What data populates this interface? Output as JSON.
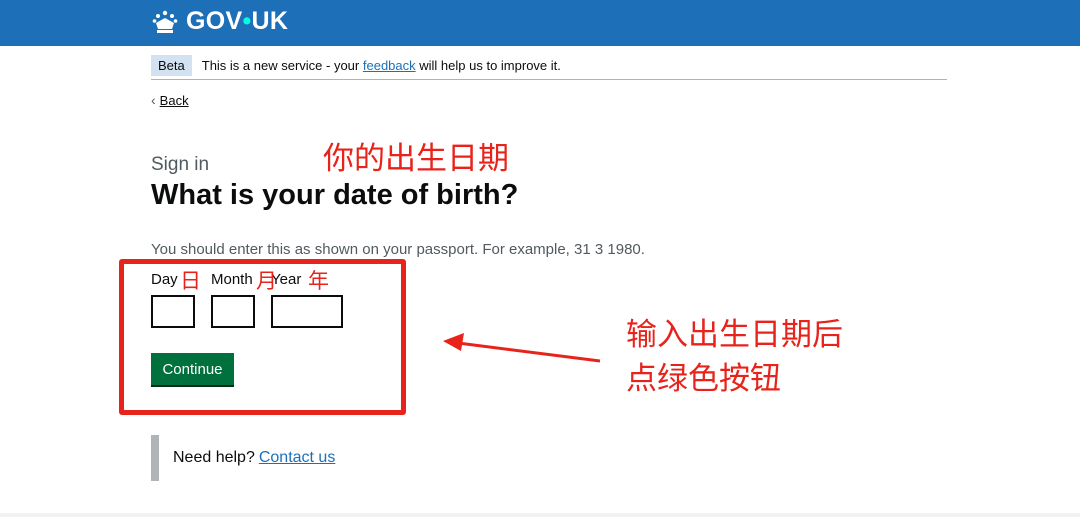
{
  "header": {
    "logo_text_left": "GOV",
    "logo_dot": "•",
    "logo_text_right": "UK",
    "brand_color": "#1d70b8"
  },
  "phase_banner": {
    "tag": "Beta",
    "text_before": "This is a new service - your",
    "link": "feedback",
    "text_after": "will help us to improve it."
  },
  "back": {
    "chevron": "‹",
    "label": "Back"
  },
  "page": {
    "caption": "Sign in",
    "title": "What is your date of birth?",
    "hint": "You should enter this as shown on your passport. For example, 31 3 1980."
  },
  "date": {
    "day_label": "Day",
    "month_label": "Month",
    "year_label": "Year",
    "day_value": "",
    "month_value": "",
    "year_value": ""
  },
  "actions": {
    "continue_label": "Continue",
    "continue_color": "#00703c"
  },
  "help": {
    "text": "Need help?",
    "link": "Contact us"
  },
  "annotations": {
    "color": "#e8231b",
    "title_note": "你的出生日期",
    "day_note": "日",
    "month_note": "月",
    "year_note": "年",
    "instruction_line1": "输入出生日期后",
    "instruction_line2": "点绿色按钮"
  }
}
